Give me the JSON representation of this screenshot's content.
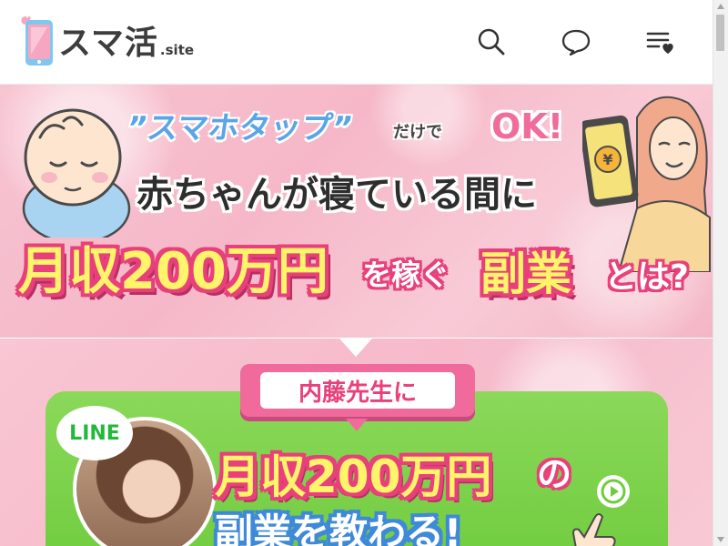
{
  "header": {
    "logo_text": "スマ活",
    "logo_suffix": ".site",
    "icons": [
      "search-icon",
      "chat-icon",
      "favorite-list-icon"
    ]
  },
  "hero": {
    "tagline": "”スマホタップ”",
    "tagline_suffix": "だけで",
    "ok": "OK!",
    "line2": "赤ちゃんが寝ている間に",
    "income": "月収200万円",
    "earn": "を稼ぐ",
    "side_job": "副業",
    "question": "とは?"
  },
  "banner2": {
    "tag": "内藤先生に",
    "line_badge": "LINE",
    "income": "月収200万円",
    "no": "の",
    "teach": "副業を教わる!"
  },
  "colors": {
    "pink": "#e8407a",
    "yellow": "#fff46a",
    "green": "#6fcc3d",
    "blue": "#5aa5e8"
  }
}
